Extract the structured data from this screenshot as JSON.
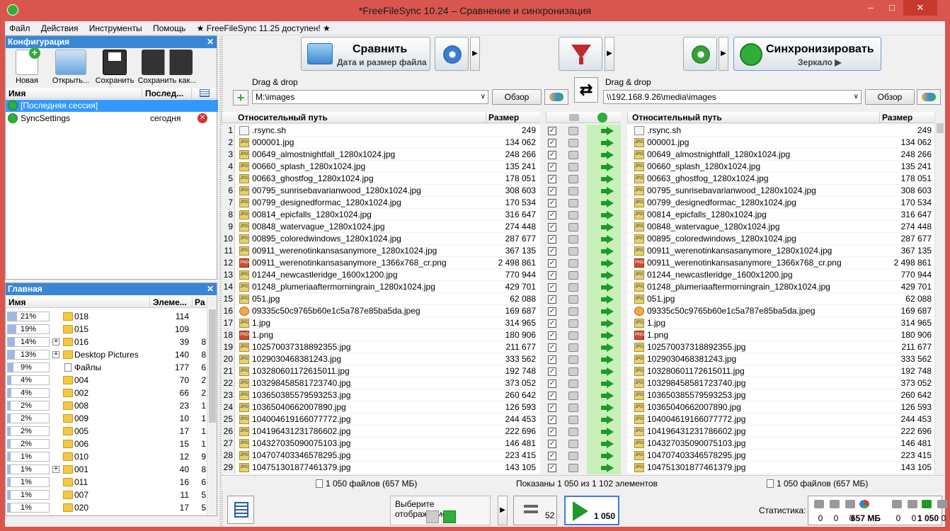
{
  "window": {
    "title": "*FreeFileSync 10.24 – Сравнение и синхронизация"
  },
  "menu": {
    "items": [
      "Файл",
      "Действия",
      "Инструменты",
      "Помощь",
      "★ FreeFileSync 11.25 доступен! ★"
    ]
  },
  "config_panel": {
    "title": "Конфигурация",
    "buttons": [
      "Новая",
      "Открыть...",
      "Сохранить",
      "Сохранить как..."
    ],
    "col_name": "Имя",
    "col_last": "Послед...",
    "sessions": [
      {
        "name": "[Последняя сессия]",
        "last": "",
        "selected": true
      },
      {
        "name": "SyncSettings",
        "last": "сегодня",
        "selected": false
      }
    ]
  },
  "overview_panel": {
    "title": "Главная",
    "col_name": "Имя",
    "col_items": "Элеме...",
    "col_size": "Ра",
    "rows": [
      {
        "pct": "21%",
        "fill": 21,
        "name": "018",
        "items": "114",
        "size": "",
        "expand": false,
        "folder": true
      },
      {
        "pct": "19%",
        "fill": 19,
        "name": "015",
        "items": "109",
        "size": "",
        "expand": false,
        "folder": true
      },
      {
        "pct": "14%",
        "fill": 14,
        "name": "016",
        "items": "39",
        "size": "8",
        "expand": true,
        "folder": true
      },
      {
        "pct": "13%",
        "fill": 13,
        "name": "Desktop Pictures",
        "items": "140",
        "size": "8",
        "expand": true,
        "folder": true
      },
      {
        "pct": "9%",
        "fill": 9,
        "name": "Файлы",
        "items": "177",
        "size": "6",
        "expand": false,
        "folder": false
      },
      {
        "pct": "4%",
        "fill": 4,
        "name": "004",
        "items": "70",
        "size": "2",
        "expand": false,
        "folder": true
      },
      {
        "pct": "4%",
        "fill": 4,
        "name": "002",
        "items": "66",
        "size": "2",
        "expand": false,
        "folder": true
      },
      {
        "pct": "2%",
        "fill": 2,
        "name": "008",
        "items": "23",
        "size": "1",
        "expand": false,
        "folder": true
      },
      {
        "pct": "2%",
        "fill": 2,
        "name": "009",
        "items": "10",
        "size": "1",
        "expand": false,
        "folder": true
      },
      {
        "pct": "2%",
        "fill": 2,
        "name": "005",
        "items": "17",
        "size": "1",
        "expand": false,
        "folder": true
      },
      {
        "pct": "2%",
        "fill": 2,
        "name": "006",
        "items": "15",
        "size": "1",
        "expand": false,
        "folder": true
      },
      {
        "pct": "1%",
        "fill": 1,
        "name": "010",
        "items": "12",
        "size": "9",
        "expand": false,
        "folder": true
      },
      {
        "pct": "1%",
        "fill": 1,
        "name": "001",
        "items": "40",
        "size": "8",
        "expand": true,
        "folder": true
      },
      {
        "pct": "1%",
        "fill": 1,
        "name": "011",
        "items": "16",
        "size": "6",
        "expand": false,
        "folder": true
      },
      {
        "pct": "1%",
        "fill": 1,
        "name": "007",
        "items": "11",
        "size": "5",
        "expand": false,
        "folder": true
      },
      {
        "pct": "1%",
        "fill": 1,
        "name": "020",
        "items": "17",
        "size": "5",
        "expand": false,
        "folder": true
      }
    ]
  },
  "toolbar": {
    "compare_label": "Сравнить",
    "compare_sub": "Дата и размер файла",
    "sync_label": "Синхронизировать",
    "sync_sub": "Зеркало ▶"
  },
  "folders": {
    "drag_drop": "Drag & drop",
    "left_path": "M:\\images",
    "right_path": "\\\\192.168.9.26\\media\\images",
    "browse": "Обзор"
  },
  "grid": {
    "col_path": "Относительный путь",
    "col_size": "Размер",
    "rows": [
      {
        "n": "1",
        "name": ".rsync.sh",
        "size": "249",
        "type": "sh"
      },
      {
        "n": "2",
        "name": "000001.jpg",
        "size": "134 062",
        "type": "jpg"
      },
      {
        "n": "3",
        "name": "00649_almostnightfall_1280x1024.jpg",
        "size": "248 266",
        "type": "jpg"
      },
      {
        "n": "4",
        "name": "00660_splash_1280x1024.jpg",
        "size": "135 241",
        "type": "jpg"
      },
      {
        "n": "5",
        "name": "00663_ghostfog_1280x1024.jpg",
        "size": "178 051",
        "type": "jpg"
      },
      {
        "n": "6",
        "name": "00795_sunrisebavarianwood_1280x1024.jpg",
        "size": "308 603",
        "type": "jpg"
      },
      {
        "n": "7",
        "name": "00799_designedformac_1280x1024.jpg",
        "size": "170 534",
        "type": "jpg"
      },
      {
        "n": "8",
        "name": "00814_epicfalls_1280x1024.jpg",
        "size": "316 647",
        "type": "jpg"
      },
      {
        "n": "9",
        "name": "00848_watervague_1280x1024.jpg",
        "size": "274 448",
        "type": "jpg"
      },
      {
        "n": "10",
        "name": "00895_coloredwindows_1280x1024.jpg",
        "size": "287 677",
        "type": "jpg"
      },
      {
        "n": "11",
        "name": "00911_werenotinkansasanymore_1280x1024.jpg",
        "size": "367 135",
        "type": "jpg"
      },
      {
        "n": "12",
        "name": "00911_werenotinkansasanymore_1366x768_cr.png",
        "size": "2 498 861",
        "type": "png"
      },
      {
        "n": "13",
        "name": "01244_newcastleridge_1600x1200.jpg",
        "size": "770 944",
        "type": "jpg"
      },
      {
        "n": "14",
        "name": "01248_plumeriaaftermorningrain_1280x1024.jpg",
        "size": "429 701",
        "type": "jpg"
      },
      {
        "n": "15",
        "name": "051.jpg",
        "size": "62 088",
        "type": "jpg"
      },
      {
        "n": "16",
        "name": "09335c50c9765b60e1c5a787e85ba5da.jpeg",
        "size": "169 687",
        "type": "jpeg"
      },
      {
        "n": "17",
        "name": "1.jpg",
        "size": "314 965",
        "type": "jpg"
      },
      {
        "n": "18",
        "name": "1.png",
        "size": "180 906",
        "type": "png"
      },
      {
        "n": "19",
        "name": "102570037318892355.jpg",
        "size": "211 677",
        "type": "jpg"
      },
      {
        "n": "20",
        "name": "1029030468381243.jpg",
        "size": "333 562",
        "type": "jpg"
      },
      {
        "n": "21",
        "name": "103280601172615011.jpg",
        "size": "192 748",
        "type": "jpg"
      },
      {
        "n": "22",
        "name": "103298458581723740.jpg",
        "size": "373 052",
        "type": "jpg"
      },
      {
        "n": "23",
        "name": "103650385579593253.jpg",
        "size": "260 642",
        "type": "jpg"
      },
      {
        "n": "24",
        "name": "10365040662007890.jpg",
        "size": "126 593",
        "type": "jpg"
      },
      {
        "n": "25",
        "name": "104004619166077772.jpg",
        "size": "244 453",
        "type": "jpg"
      },
      {
        "n": "26",
        "name": "104196431231786602.jpg",
        "size": "222 696",
        "type": "jpg"
      },
      {
        "n": "27",
        "name": "104327035090075103.jpg",
        "size": "146 481",
        "type": "jpg"
      },
      {
        "n": "28",
        "name": "104707403346578295.jpg",
        "size": "223 415",
        "type": "jpg"
      },
      {
        "n": "29",
        "name": "104751301877461379.jpg",
        "size": "143 105",
        "type": "jpg"
      }
    ]
  },
  "status": {
    "left": "1 050 файлов (657 МБ)",
    "middle": "Показаны 1 050 из 1 102 элементов",
    "right": "1 050 файлов (657 МБ)"
  },
  "bottom": {
    "view_label": "Выберите отображение:",
    "equal_count": "52",
    "sync_count": "1 050",
    "stats_label": "Статистика:",
    "stats": [
      "0",
      "0",
      "0",
      "657 МБ",
      "0",
      "0",
      "1 050",
      "0"
    ]
  },
  "colors": {
    "accent": "#3a86d6",
    "titlebar": "#d9564f",
    "selected": "#3399ff",
    "sync_col": "#c8f0b8"
  }
}
